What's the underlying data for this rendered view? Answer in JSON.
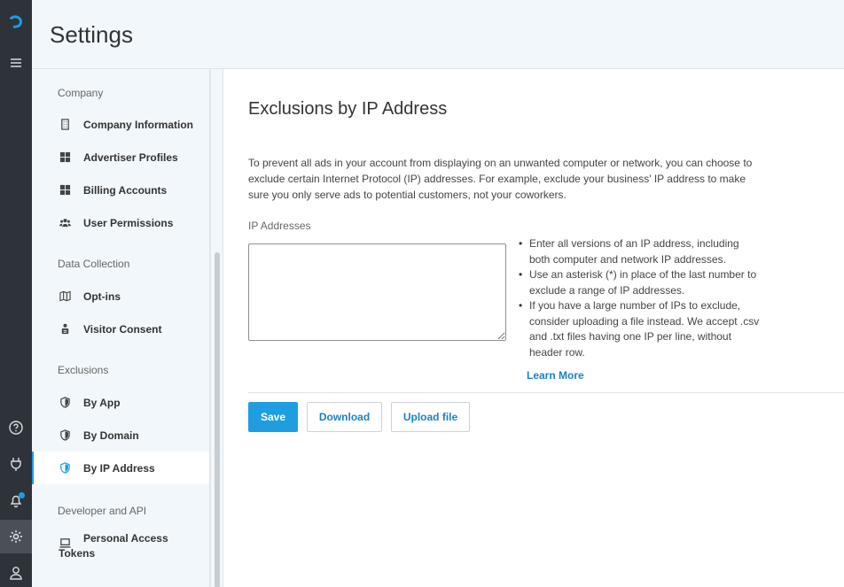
{
  "header": {
    "title": "Settings"
  },
  "rail": {
    "colors": {
      "accent": "#1e9ee0",
      "background": "#2e333a"
    }
  },
  "nav": {
    "sections": [
      {
        "label": "Company"
      },
      {
        "label": "Data Collection"
      },
      {
        "label": "Exclusions"
      },
      {
        "label": "Developer and API"
      }
    ],
    "items": [
      {
        "label": "Company Information",
        "icon": "building-icon"
      },
      {
        "label": "Advertiser Profiles",
        "icon": "grid-icon"
      },
      {
        "label": "Billing Accounts",
        "icon": "grid-icon"
      },
      {
        "label": "User Permissions",
        "icon": "users-icon"
      },
      {
        "label": "Opt-ins",
        "icon": "map-icon"
      },
      {
        "label": "Visitor Consent",
        "icon": "person-lock-icon"
      },
      {
        "label": "By App",
        "icon": "shield-icon"
      },
      {
        "label": "By Domain",
        "icon": "shield-icon"
      },
      {
        "label": "By IP Address",
        "icon": "shield-icon",
        "active": true
      },
      {
        "label": "Personal Access",
        "label2": "Tokens",
        "icon": "laptop-icon"
      }
    ]
  },
  "main": {
    "title": "Exclusions by IP Address",
    "description": "To prevent all ads in your account from displaying on an unwanted computer or network, you can choose to exclude certain Internet Protocol (IP) addresses. For example, exclude your business' IP address to make sure you only serve ads to potential customers, not your coworkers.",
    "field_label": "IP Addresses",
    "input_value": "",
    "hints": [
      "Enter all versions of an IP address, including both computer and network IP addresses.",
      "Use an asterisk (*) in place of the last number to exclude a range of IP addresses.",
      "If you have a large number of IPs to exclude, consider uploading a file instead. We accept .csv and .txt files having one IP per line, without header row."
    ],
    "learn_more": "Learn More",
    "buttons": {
      "save": "Save",
      "download": "Download",
      "upload": "Upload file"
    }
  }
}
